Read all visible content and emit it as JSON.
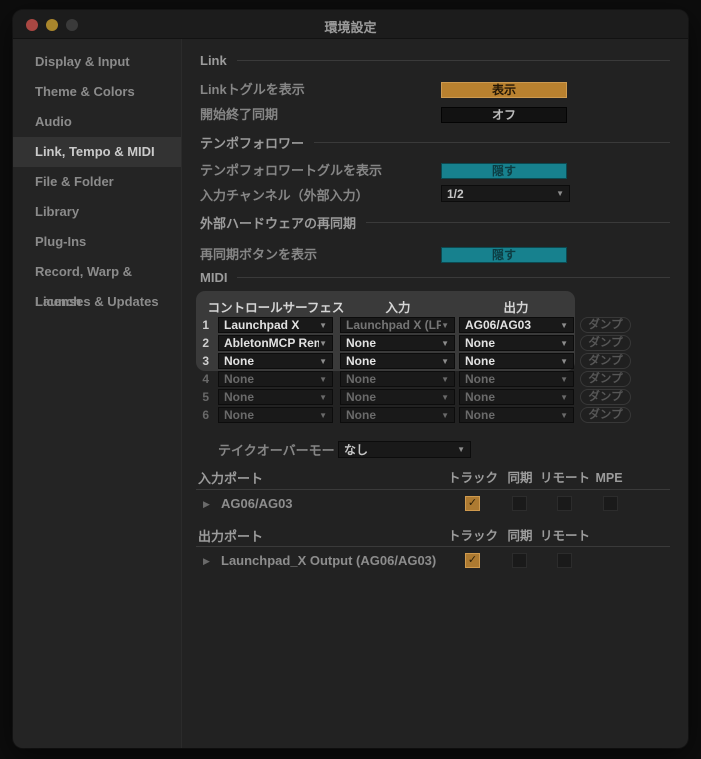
{
  "titlebar": {
    "title": "環境設定"
  },
  "sidebar": {
    "items": [
      {
        "label": "Display & Input",
        "selected": false
      },
      {
        "label": "Theme & Colors",
        "selected": false
      },
      {
        "label": "Audio",
        "selected": false
      },
      {
        "label": "Link, Tempo & MIDI",
        "selected": true
      },
      {
        "label": "File & Folder",
        "selected": false
      },
      {
        "label": "Library",
        "selected": false
      },
      {
        "label": "Plug-Ins",
        "selected": false
      },
      {
        "label": "Record, Warp & Launch",
        "selected": false
      },
      {
        "label": "Licenses & Updates",
        "selected": false
      }
    ]
  },
  "link": {
    "title": "Link",
    "toggle_row": {
      "label": "Linkトグルを表示",
      "value": "表示"
    },
    "sync_row": {
      "label": "開始終了同期",
      "value": "オフ"
    }
  },
  "tempo_follower": {
    "title": "テンポフォロワー",
    "toggle_row": {
      "label": "テンポフォロワートグルを表示",
      "value": "隠す"
    },
    "channel_row": {
      "label": "入力チャンネル（外部入力）",
      "value": "1/2"
    }
  },
  "resync": {
    "title": "外部ハードウェアの再同期",
    "toggle_row": {
      "label": "再同期ボタンを表示",
      "value": "隠す"
    }
  },
  "midi": {
    "title": "MIDI",
    "headers": {
      "surface": "コントロールサーフェス",
      "input": "入力",
      "output": "出力"
    },
    "dump_label": "ダンプ",
    "takeover": {
      "label": "テイクオーバーモード",
      "value": "なし"
    },
    "rows": [
      {
        "num": "1",
        "surface": "Launchpad X",
        "input": "Launchpad X (LP)",
        "output": "AG06/AG03"
      },
      {
        "num": "2",
        "surface": "AbletonMCP Rem",
        "input": "None",
        "output": "None"
      },
      {
        "num": "3",
        "surface": "None",
        "input": "None",
        "output": "None"
      },
      {
        "num": "4",
        "surface": "None",
        "input": "None",
        "output": "None"
      },
      {
        "num": "5",
        "surface": "None",
        "input": "None",
        "output": "None"
      },
      {
        "num": "6",
        "surface": "None",
        "input": "None",
        "output": "None"
      }
    ]
  },
  "input_ports": {
    "title": "入力ポート",
    "columns": [
      "トラック",
      "同期",
      "リモート",
      "MPE"
    ],
    "rows": [
      {
        "name": "AG06/AG03",
        "track": true,
        "sync": false,
        "remote": false,
        "mpe": false
      }
    ]
  },
  "output_ports": {
    "title": "出力ポート",
    "columns": [
      "トラック",
      "同期",
      "リモート"
    ],
    "rows": [
      {
        "name": "Launchpad_X Output (AG06/AG03)",
        "track": true,
        "sync": false,
        "remote": false
      }
    ]
  },
  "icons": {
    "dropdown_arrow": "▼",
    "expand_triangle": "▶",
    "check": "✓"
  },
  "colors": {
    "accent_orange": "#b9812f",
    "accent_teal": "#17818e",
    "checkbox_checked": "#ad7a31",
    "window_bg": "#222222",
    "titlebar_bg": "#1c1c1c",
    "sidebar_selected_bg": "#333333"
  }
}
